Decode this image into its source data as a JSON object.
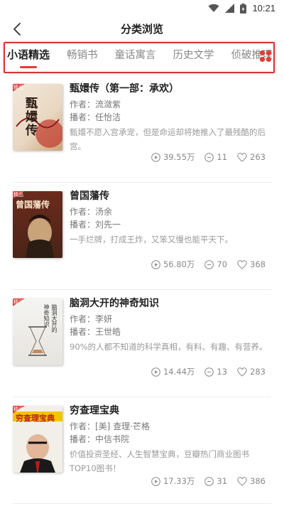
{
  "status_bar": {
    "time": "10:21"
  },
  "header": {
    "title": "分类浏览"
  },
  "tabs": [
    {
      "label": "小语精选",
      "active": true
    },
    {
      "label": "畅销书",
      "active": false
    },
    {
      "label": "童话寓言",
      "active": false
    },
    {
      "label": "历史文学",
      "active": false
    },
    {
      "label": "侦破推理",
      "active": false
    }
  ],
  "colors": {
    "accent": "#e23b35",
    "highlight_box": "#d8322f"
  },
  "books": [
    {
      "title": "甄嬛传（第一部：承欢）",
      "author": "作者：流潋紫",
      "narrator": "播者：任怡洁",
      "description": "甄嬛不愿入宫承宠，但是命运却将她推入了最残酷的后宫。",
      "plays": "39.55万",
      "comments": "11",
      "likes": "263",
      "badge": "精品",
      "cover_text": "甄嬛传"
    },
    {
      "title": "曾国藩传",
      "author": "作者：汤余",
      "narrator": "播者：刘先一",
      "description": "一手烂牌，打成王炸，又笨又慢也能平天下。",
      "plays": "56.80万",
      "comments": "70",
      "likes": "368",
      "badge": "精品",
      "cover_text": "曾国藩传"
    },
    {
      "title": "脑洞大开的神奇知识",
      "author": "作者：李妍",
      "narrator": "播者：王世皓",
      "description": "90%的人都不知道的科学真相，有料、有趣、有营养。",
      "plays": "14.44万",
      "comments": "13",
      "likes": "283",
      "badge": "精品",
      "cover_text": "脑洞大开的神奇知识"
    },
    {
      "title": "穷查理宝典",
      "author": "作者：[美] 查理·芒格",
      "narrator": "播者：中信书院",
      "description": "价值投资圣经、人生智慧宝典，豆瓣热门商业图书TOP10图书！",
      "plays": "17.33万",
      "comments": "31",
      "likes": "386",
      "badge": "精品",
      "cover_text": "穷查理宝典"
    }
  ]
}
